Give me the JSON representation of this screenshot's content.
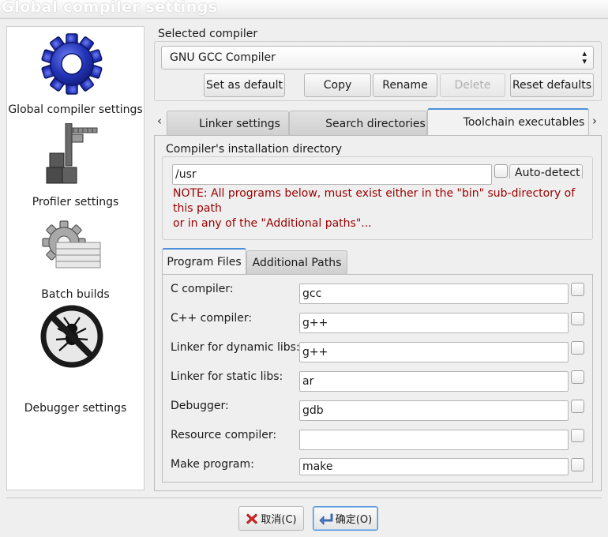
{
  "window": {
    "title": "Global compiler settings"
  },
  "sidebar": {
    "items": [
      {
        "label": "Global compiler settings",
        "icon": "gear-icon"
      },
      {
        "label": "Profiler settings",
        "icon": "caliper-icon"
      },
      {
        "label": "Batch builds",
        "icon": "batch-gear-icon"
      },
      {
        "label": "Debugger settings",
        "icon": "no-bug-icon"
      }
    ]
  },
  "compiler": {
    "group_title": "Selected compiler",
    "selected": "GNU GCC Compiler",
    "buttons": {
      "set_default": "Set as default",
      "copy": "Copy",
      "rename": "Rename",
      "delete": "Delete",
      "reset": "Reset defaults"
    }
  },
  "tabs": {
    "scroll_left": "‹",
    "scroll_right": "›",
    "items": [
      "Linker settings",
      "Search directories",
      "Toolchain executables"
    ],
    "active": "Toolchain executables"
  },
  "install_dir": {
    "group_title": "Compiler's installation directory",
    "value": "/usr",
    "auto_detect": "Auto-detect",
    "note_line1": "NOTE: All programs below, must exist either in the \"bin\" sub-directory of",
    "note_line2": "this path",
    "note_line3": "or in any of the \"Additional paths\"..."
  },
  "subtabs": {
    "items": [
      "Program Files",
      "Additional Paths"
    ],
    "active": "Program Files"
  },
  "programs": [
    {
      "label": "C compiler:",
      "value": "gcc"
    },
    {
      "label": "C++ compiler:",
      "value": "g++"
    },
    {
      "label": "Linker for dynamic libs:",
      "value": "g++"
    },
    {
      "label": "Linker for static libs:",
      "value": "ar"
    },
    {
      "label": "Debugger:",
      "value": "gdb"
    },
    {
      "label": "Resource compiler:",
      "value": ""
    },
    {
      "label": "Make program:",
      "value": "make"
    }
  ],
  "footer": {
    "cancel": "取消(C)",
    "ok": "确定(O)"
  },
  "colors": {
    "note_text": "#990000",
    "active_tab_accent": "#4a90d9",
    "gear_blue": "#2233b8"
  }
}
